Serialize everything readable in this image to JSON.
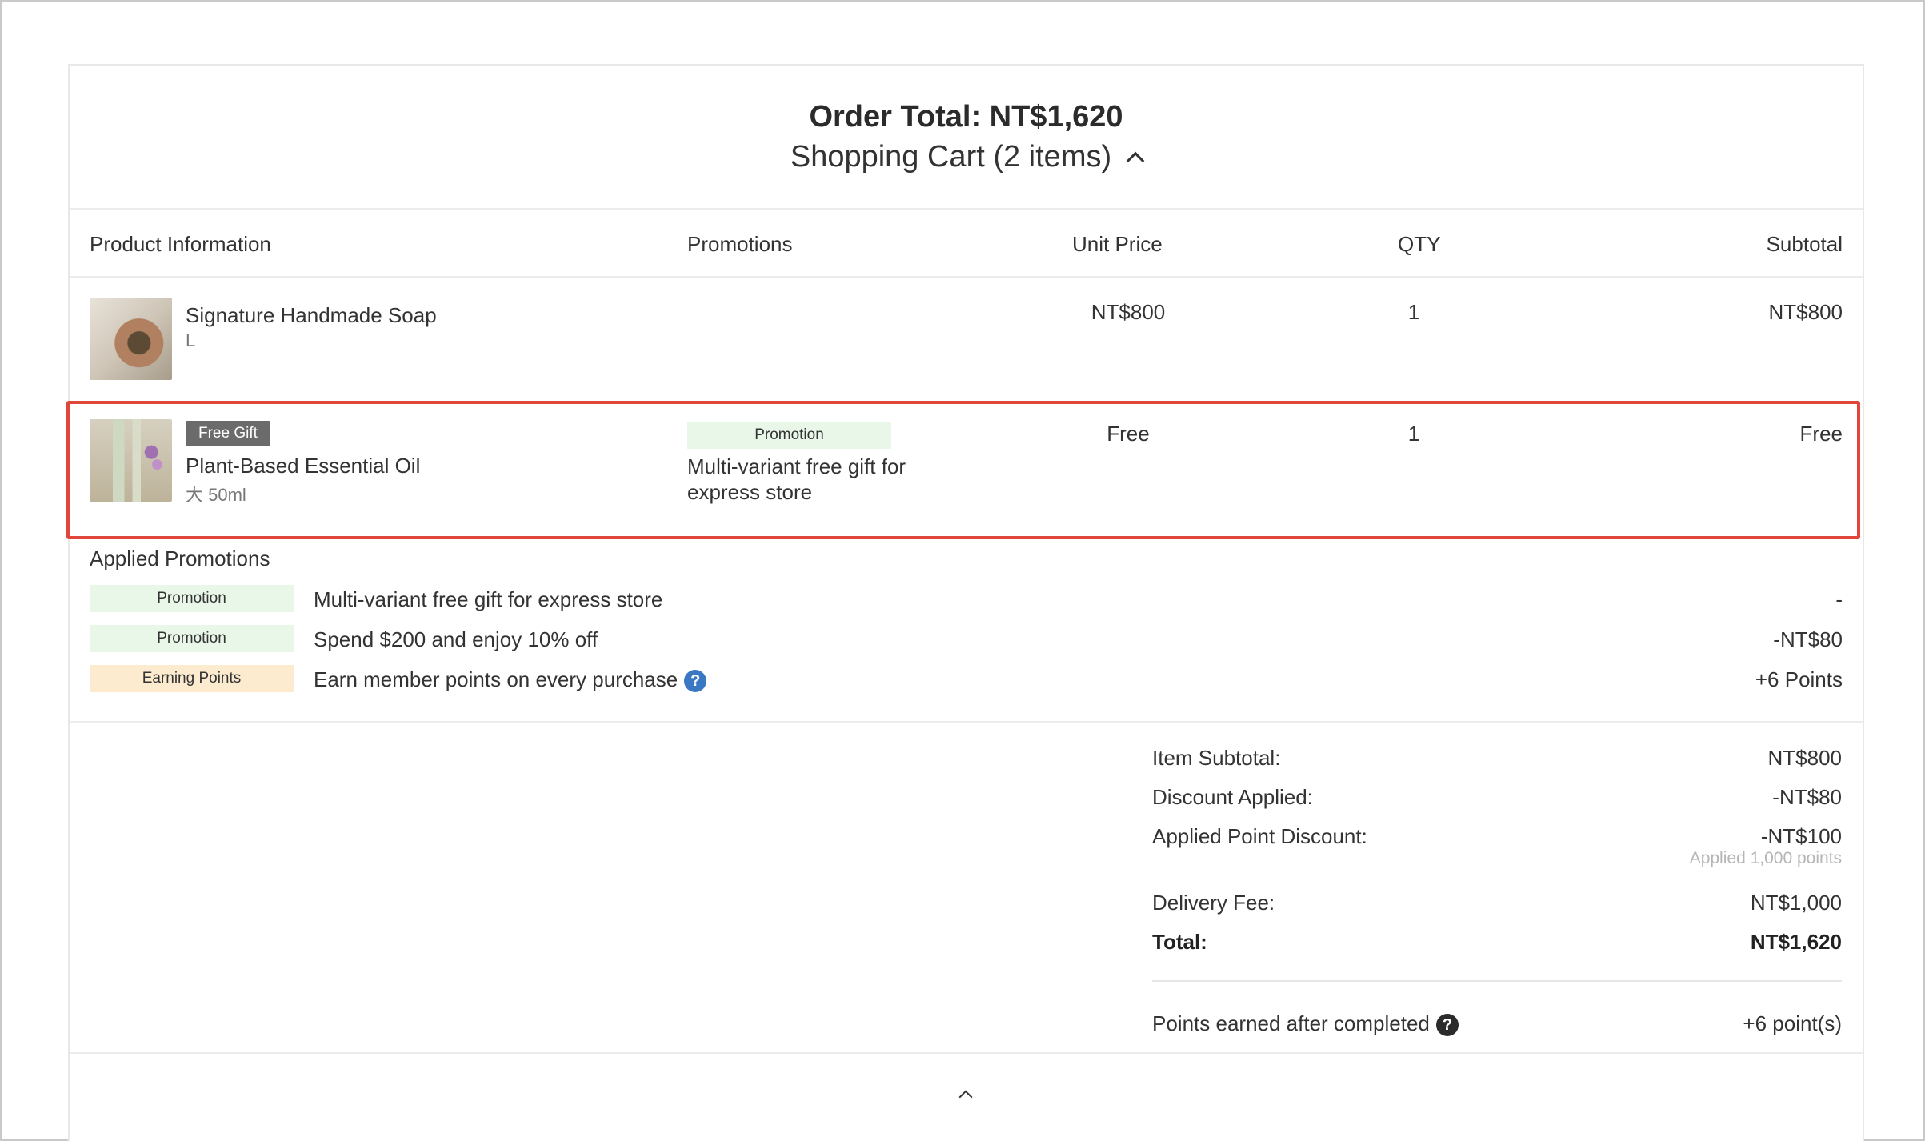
{
  "header": {
    "order_total": "Order Total: NT$1,620",
    "cart_label": "Shopping Cart (2 items)",
    "toggle_icon": "chevron-up-icon"
  },
  "table": {
    "columns": {
      "product": "Product Information",
      "promotions": "Promotions",
      "unit_price": "Unit Price",
      "qty": "QTY",
      "subtotal": "Subtotal"
    },
    "items": [
      {
        "name": "Signature Handmade Soap",
        "variant": "L",
        "unit_price": "NT$800",
        "qty": "1",
        "subtotal": "NT$800"
      },
      {
        "badge": "Free Gift",
        "name": "Plant-Based Essential Oil",
        "variant": "大 50ml",
        "promo_badge": "Promotion",
        "promo_text_line1": "Multi-variant free gift for",
        "promo_text_line2": "express store",
        "unit_price": "Free",
        "qty": "1",
        "subtotal": "Free"
      }
    ]
  },
  "applied_promotions": {
    "title": "Applied Promotions",
    "rows": [
      {
        "badge": "Promotion",
        "text": "Multi-variant free gift for express store",
        "value": "-"
      },
      {
        "badge": "Promotion",
        "text": "Spend $200 and enjoy 10% off",
        "value": "-NT$80"
      },
      {
        "badge": "Earning Points",
        "text": "Earn member points on every purchase",
        "value": "+6 Points"
      }
    ]
  },
  "summary": {
    "item_subtotal_label": "Item Subtotal:",
    "item_subtotal_value": "NT$800",
    "discount_label": "Discount Applied:",
    "discount_value": "-NT$80",
    "point_discount_label": "Applied Point Discount:",
    "point_discount_value": "-NT$100",
    "point_discount_note": "Applied 1,000 points",
    "delivery_label": "Delivery Fee:",
    "delivery_value": "NT$1,000",
    "total_label": "Total:",
    "total_value": "NT$1,620",
    "points_earned_label": "Points earned after completed",
    "points_earned_value": "+6 point(s)"
  },
  "icons": {
    "help": "?",
    "help_color": "#3b78c4",
    "highlight_color": "#e0463a"
  }
}
